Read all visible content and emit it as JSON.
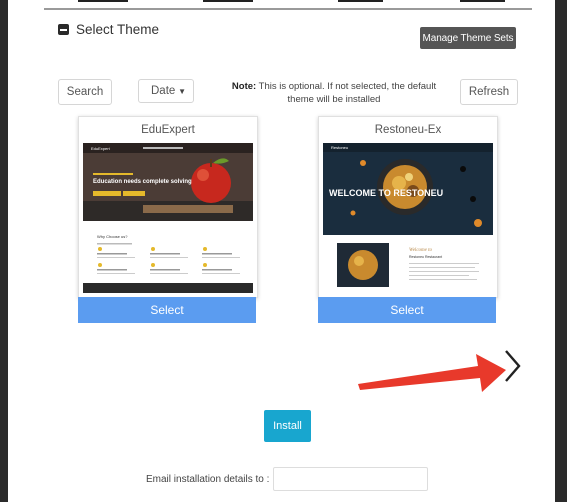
{
  "section": {
    "title": "Select Theme",
    "manage_label": "Manage Theme Sets"
  },
  "toolbar": {
    "search_label": "Search",
    "sort_value": "Date",
    "note_bold": "Note:",
    "note_text": " This is optional. If not selected, the default theme will be installed",
    "refresh_label": "Refresh"
  },
  "themes": [
    {
      "name": "EduExpert",
      "select_label": "Select",
      "preview": {
        "brand": "EduExpert",
        "headline": "Education needs complete solving",
        "section_heading": "Why Choose us?"
      }
    },
    {
      "name": "Restoneu-Ex",
      "select_label": "Select",
      "preview": {
        "brand": "Restoneu",
        "headline": "WELCOME TO RESTONEU",
        "welcome": "Welcome to",
        "subheading": "Restoneu Restaurant"
      }
    }
  ],
  "install": {
    "label": "Install",
    "email_label": "Email installation details to :",
    "email_value": ""
  },
  "colors": {
    "select_button": "#5b9cf0",
    "install_button": "#18a6cf",
    "annotation_arrow": "#e8392b"
  }
}
